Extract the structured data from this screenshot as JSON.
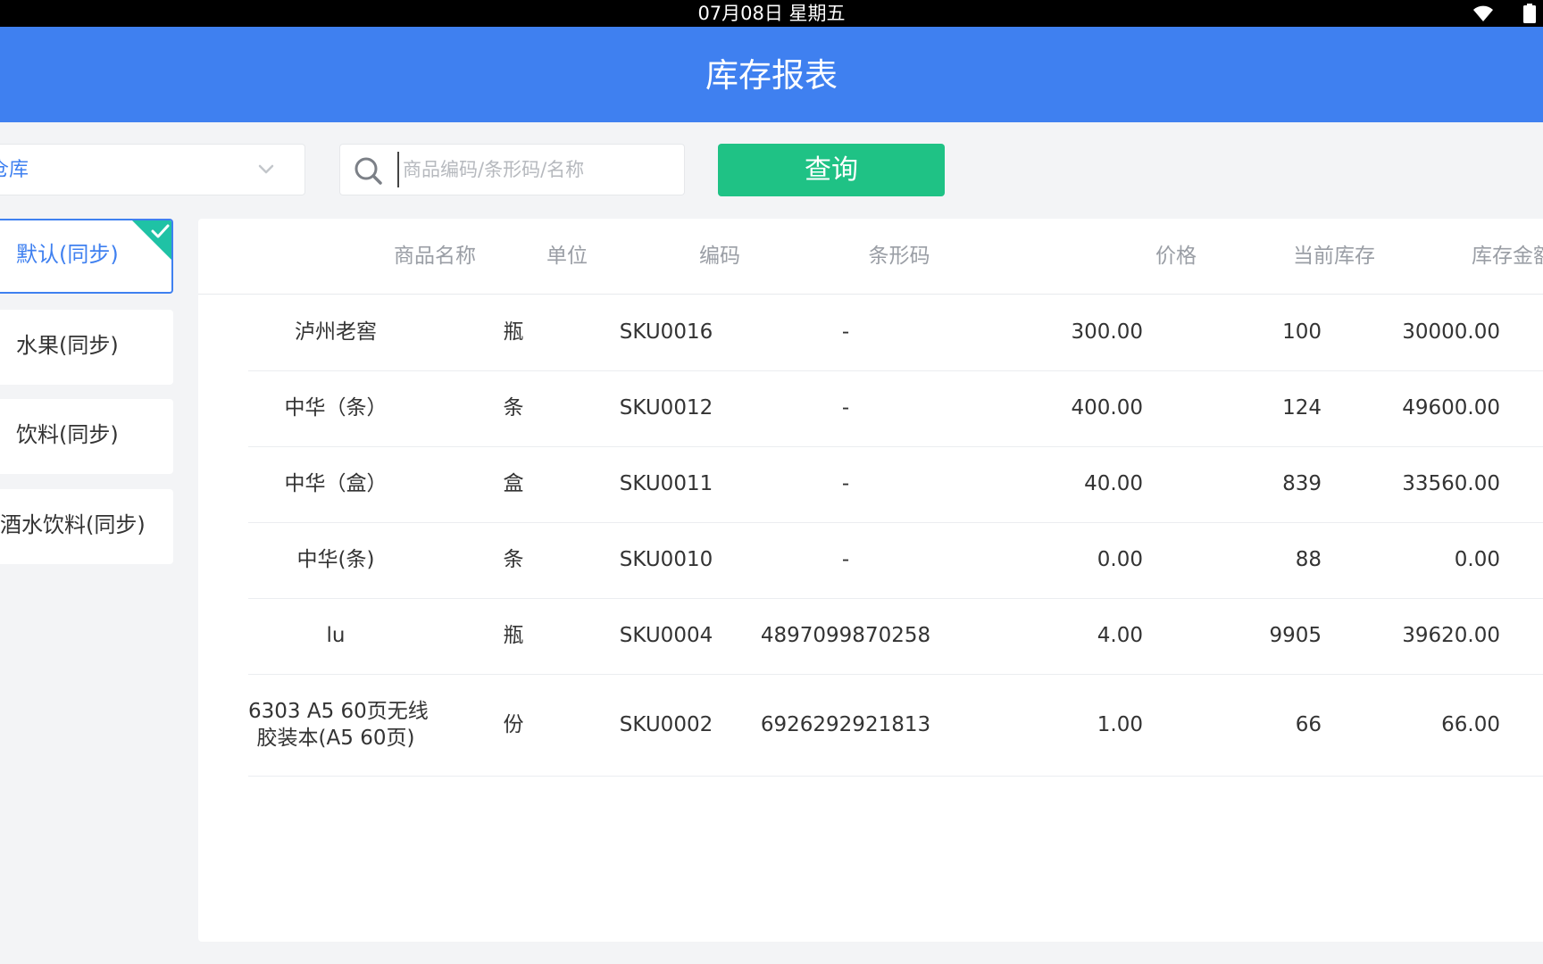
{
  "status_bar": {
    "time": "07月08日 星期五"
  },
  "header": {
    "title": "库存报表"
  },
  "filters": {
    "warehouse_value": "仓库",
    "search_placeholder": "商品编码/条形码/名称",
    "query_label": "查询"
  },
  "categories": [
    {
      "label": "默认(同步)",
      "selected": true
    },
    {
      "label": "水果(同步)",
      "selected": false
    },
    {
      "label": "饮料(同步)",
      "selected": false
    },
    {
      "label": "酒水饮料(同步)",
      "selected": false
    }
  ],
  "table": {
    "columns": [
      "商品名称",
      "单位",
      "编码",
      "条形码",
      "价格",
      "当前库存",
      "库存金额"
    ],
    "rows": [
      {
        "name": "泸州老窖",
        "name_line2": "",
        "unit": "瓶",
        "code": "SKU0016",
        "barcode": "-",
        "price": "300.00",
        "stock": "100",
        "amount": "30000.00"
      },
      {
        "name": "中华（条）",
        "name_line2": "",
        "unit": "条",
        "code": "SKU0012",
        "barcode": "-",
        "price": "400.00",
        "stock": "124",
        "amount": "49600.00"
      },
      {
        "name": "中华（盒）",
        "name_line2": "",
        "unit": "盒",
        "code": "SKU0011",
        "barcode": "-",
        "price": "40.00",
        "stock": "839",
        "amount": "33560.00"
      },
      {
        "name": "中华(条)",
        "name_line2": "",
        "unit": "条",
        "code": "SKU0010",
        "barcode": "-",
        "price": "0.00",
        "stock": "88",
        "amount": "0.00"
      },
      {
        "name": "lu",
        "name_line2": "",
        "unit": "瓶",
        "code": "SKU0004",
        "barcode": "4897099870258",
        "price": "4.00",
        "stock": "9905",
        "amount": "39620.00"
      },
      {
        "name": "6303 A5 60页无线",
        "name_line2": "胶装本(A5 60页)",
        "unit": "份",
        "code": "SKU0002",
        "barcode": "6926292921813",
        "price": "1.00",
        "stock": "66",
        "amount": "66.00"
      }
    ]
  },
  "colors": {
    "primary": "#3f80f0",
    "query_button": "#1fc285",
    "check_badge": "#1fc2a5"
  },
  "icons": {
    "wifi": "wifi-icon",
    "battery": "battery-icon",
    "dropdown": "chevron-down-icon",
    "search": "search-icon",
    "check": "checkmark-icon"
  }
}
